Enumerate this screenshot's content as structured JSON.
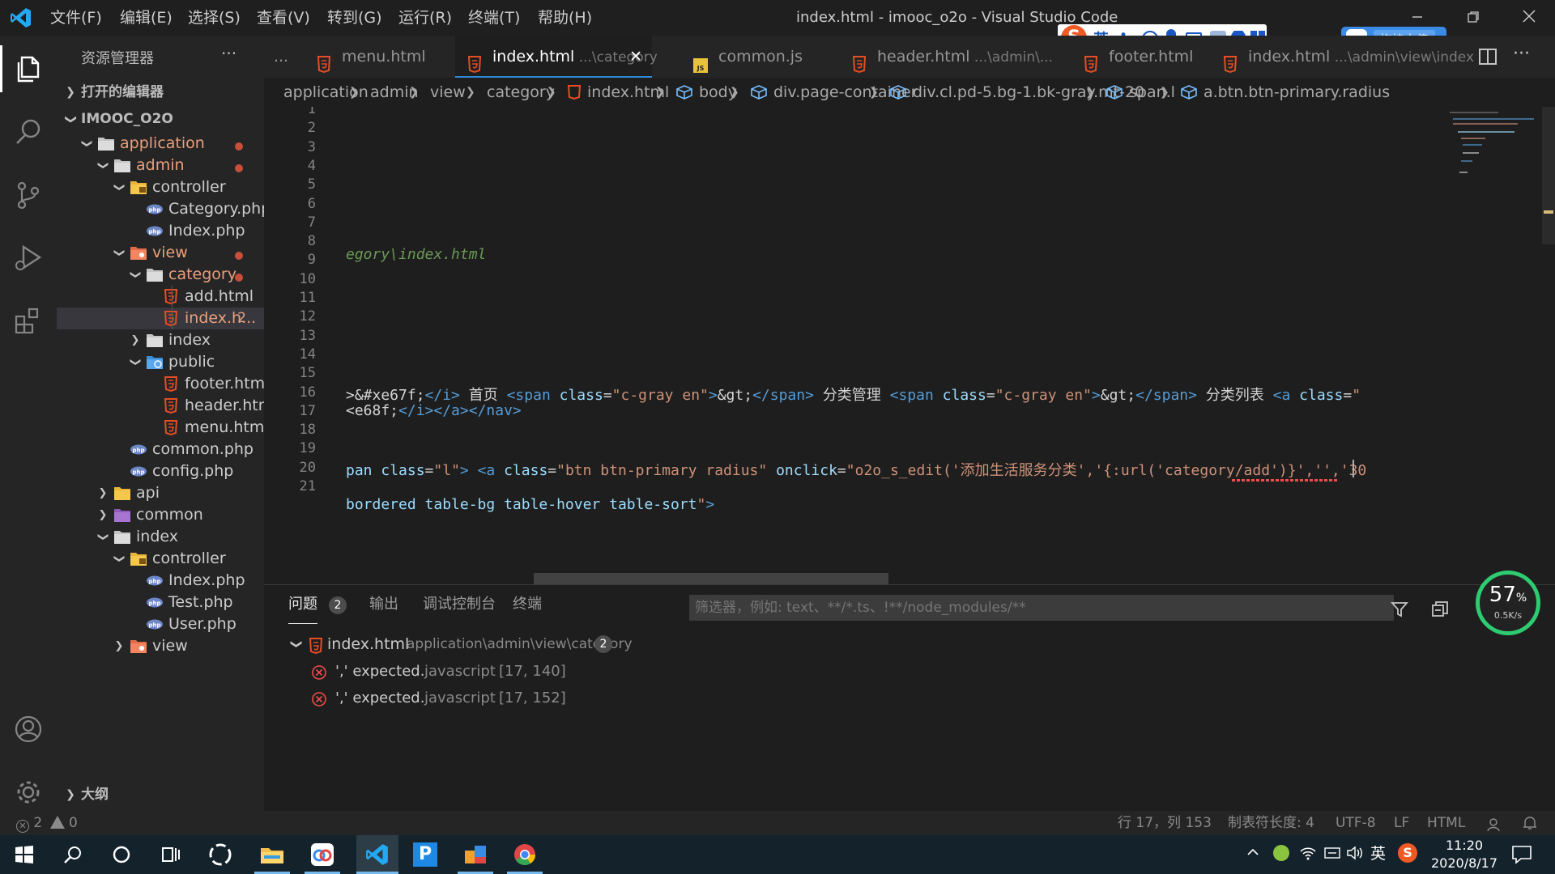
{
  "titlebar": {
    "menus": [
      "文件(F)",
      "编辑(E)",
      "选择(S)",
      "查看(V)",
      "转到(G)",
      "运行(R)",
      "终端(T)",
      "帮助(H)"
    ],
    "title": "index.html - imooc_o2o - Visual Studio Code"
  },
  "sidebar": {
    "title": "资源管理器",
    "more": "···",
    "open_editors": "打开的编辑器",
    "project": "IMOOC_O2O",
    "outline": "大纲",
    "tree": [
      {
        "label": "application",
        "depth": 1,
        "type": "folder",
        "expanded": true,
        "modified": true
      },
      {
        "label": "admin",
        "depth": 2,
        "type": "folder",
        "expanded": true,
        "modified": true
      },
      {
        "label": "controller",
        "depth": 3,
        "type": "folder-controller",
        "expanded": true
      },
      {
        "label": "Category.php",
        "depth": 4,
        "type": "php"
      },
      {
        "label": "Index.php",
        "depth": 4,
        "type": "php"
      },
      {
        "label": "view",
        "depth": 3,
        "type": "folder-view",
        "expanded": true,
        "modified": true
      },
      {
        "label": "category",
        "depth": 4,
        "type": "folder",
        "expanded": true,
        "modified": true
      },
      {
        "label": "add.html",
        "depth": 5,
        "type": "html"
      },
      {
        "label": "index.h...",
        "depth": 5,
        "type": "html",
        "badge": "2",
        "selected": true
      },
      {
        "label": "index",
        "depth": 4,
        "type": "folder",
        "expanded": false
      },
      {
        "label": "public",
        "depth": 4,
        "type": "folder-public",
        "expanded": true
      },
      {
        "label": "footer.html",
        "depth": 5,
        "type": "html"
      },
      {
        "label": "header.html",
        "depth": 5,
        "type": "html"
      },
      {
        "label": "menu.html",
        "depth": 5,
        "type": "html"
      },
      {
        "label": "common.php",
        "depth": 3,
        "type": "php"
      },
      {
        "label": "config.php",
        "depth": 3,
        "type": "php"
      },
      {
        "label": "api",
        "depth": 2,
        "type": "folder-api",
        "expanded": false
      },
      {
        "label": "common",
        "depth": 2,
        "type": "folder-common",
        "expanded": false
      },
      {
        "label": "index",
        "depth": 2,
        "type": "folder",
        "expanded": true
      },
      {
        "label": "controller",
        "depth": 3,
        "type": "folder-controller",
        "expanded": true
      },
      {
        "label": "Index.php",
        "depth": 4,
        "type": "php"
      },
      {
        "label": "Test.php",
        "depth": 4,
        "type": "php"
      },
      {
        "label": "User.php",
        "depth": 4,
        "type": "php"
      },
      {
        "label": "view",
        "depth": 3,
        "type": "folder-view",
        "expanded": false
      }
    ]
  },
  "tabs": [
    {
      "label": "menu.html",
      "desc": "",
      "icon": "html"
    },
    {
      "label": "index.html",
      "desc": "...\\category",
      "icon": "html",
      "active": true,
      "close": "✕"
    },
    {
      "label": "common.js",
      "desc": "",
      "icon": "js"
    },
    {
      "label": "header.html",
      "desc": "...\\admin\\...",
      "icon": "html"
    },
    {
      "label": "footer.html",
      "desc": "",
      "icon": "html"
    },
    {
      "label": "index.html",
      "desc": "...\\admin\\view\\index",
      "icon": "html"
    }
  ],
  "tabs_overflow": "...",
  "breadcrumb": [
    "application",
    "admin",
    "view",
    "category",
    "index.html",
    "body",
    "div.page-container",
    "div.cl.pd-5.bg-1.bk-gray.mt-20",
    "span.l",
    "a.btn.btn-primary.radius"
  ],
  "editor": {
    "line_numbers": [
      "1",
      "2",
      "3",
      "4",
      "5",
      "6",
      "7",
      "8",
      "9",
      "10",
      "11",
      "12",
      "13",
      "14",
      "15",
      "16",
      "17",
      "18",
      "19",
      "20",
      "21"
    ],
    "line7": "egory\\index.html",
    "line13": [
      {
        "t": "txt",
        "v": ">&#xe67f;"
      },
      {
        "t": "tag",
        "v": "</i>"
      },
      {
        "t": "txt",
        "v": " 首页 "
      },
      {
        "t": "tag",
        "v": "<span "
      },
      {
        "t": "attr",
        "v": "class"
      },
      {
        "t": "txt",
        "v": "="
      },
      {
        "t": "str",
        "v": "\"c-gray en\""
      },
      {
        "t": "tag",
        "v": ">"
      },
      {
        "t": "txt",
        "v": "&gt;"
      },
      {
        "t": "tag",
        "v": "</span>"
      },
      {
        "t": "txt",
        "v": " 分类管理 "
      },
      {
        "t": "tag",
        "v": "<span "
      },
      {
        "t": "attr",
        "v": "class"
      },
      {
        "t": "txt",
        "v": "="
      },
      {
        "t": "str",
        "v": "\"c-gray en\""
      },
      {
        "t": "tag",
        "v": ">"
      },
      {
        "t": "txt",
        "v": "&gt;"
      },
      {
        "t": "tag",
        "v": "</span>"
      },
      {
        "t": "txt",
        "v": " 分类列表 "
      },
      {
        "t": "tag",
        "v": "<a "
      },
      {
        "t": "attr",
        "v": "class"
      },
      {
        "t": "txt",
        "v": "="
      },
      {
        "t": "str",
        "v": "\""
      }
    ],
    "line14": [
      {
        "t": "txt",
        "v": "<e68f;"
      },
      {
        "t": "tag",
        "v": "</i></a></nav>"
      }
    ],
    "line17": [
      {
        "t": "attr",
        "v": "pan "
      },
      {
        "t": "attr",
        "v": "class"
      },
      {
        "t": "txt",
        "v": "="
      },
      {
        "t": "str",
        "v": "\"l\""
      },
      {
        "t": "tag",
        "v": "> <a "
      },
      {
        "t": "attr",
        "v": "class"
      },
      {
        "t": "txt",
        "v": "="
      },
      {
        "t": "str",
        "v": "\"btn btn-primary radius\" "
      },
      {
        "t": "attr",
        "v": "onclick"
      },
      {
        "t": "txt",
        "v": "="
      },
      {
        "t": "str",
        "v": "\"o2o_s_edit('添加生活服务分类','{:url('category/add')}','','30"
      }
    ],
    "line19": [
      {
        "t": "attr",
        "v": "bordered table-bg table-hover table-sort"
      },
      {
        "t": "str",
        "v": "\""
      },
      {
        "t": "tag",
        "v": ">"
      }
    ]
  },
  "panel": {
    "tabs": [
      {
        "label": "问题",
        "count": "2",
        "active": true
      },
      {
        "label": "输出"
      },
      {
        "label": "调试控制台"
      },
      {
        "label": "终端"
      }
    ],
    "filter_placeholder": "筛选器，例如: text、**/*.ts、!**/node_modules/**",
    "file": {
      "name": "index.html",
      "path": "application\\admin\\view\\category",
      "count": "2"
    },
    "problems": [
      {
        "message": "',' expected.",
        "source": "javascript",
        "pos": "[17, 140]"
      },
      {
        "message": "',' expected.",
        "source": "javascript",
        "pos": "[17, 152]"
      }
    ]
  },
  "statusbar": {
    "errors": "2",
    "warnings": "0",
    "position": "行 17，列 153",
    "tab_size": "制表符长度: 4",
    "encoding": "UTF-8",
    "eol": "LF",
    "language": "HTML"
  },
  "overlays": {
    "ime_lang": "英",
    "ime_punct": "•,",
    "upload_label": "拖拽上传",
    "net_percent": "57",
    "net_unit": "%",
    "net_speed": "0.5K/s"
  },
  "taskbar": {
    "ime_lang": "英",
    "time": "11:20",
    "date": "2020/8/17"
  },
  "colors": {
    "accent": "#007acc",
    "error": "#f14c4c",
    "modified_dot": "#c74e39",
    "folder_label": "#e9a07b"
  }
}
